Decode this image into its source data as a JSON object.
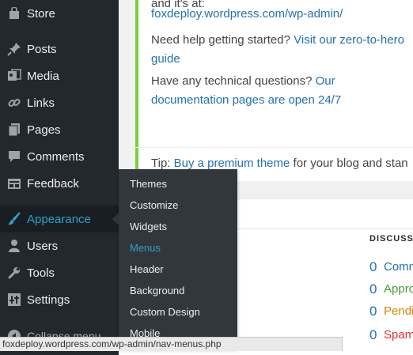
{
  "sidebar": {
    "items": [
      {
        "label": "Store",
        "icon": "store-icon"
      },
      {
        "label": "Posts",
        "icon": "pin-icon"
      },
      {
        "label": "Media",
        "icon": "media-icon"
      },
      {
        "label": "Links",
        "icon": "link-icon"
      },
      {
        "label": "Pages",
        "icon": "pages-icon"
      },
      {
        "label": "Comments",
        "icon": "comment-icon"
      },
      {
        "label": "Feedback",
        "icon": "feedback-icon"
      },
      {
        "label": "Appearance",
        "icon": "brush-icon"
      },
      {
        "label": "Users",
        "icon": "user-icon"
      },
      {
        "label": "Tools",
        "icon": "wrench-icon"
      },
      {
        "label": "Settings",
        "icon": "settings-icon"
      }
    ],
    "collapse_label": "Collapse menu",
    "active_color": "#2ea2cc"
  },
  "flyout": {
    "items": [
      "Themes",
      "Customize",
      "Widgets",
      "Menus",
      "Header",
      "Background",
      "Custom Design",
      "Mobile"
    ],
    "current": "Menus"
  },
  "main": {
    "card1": {
      "line0": "and it's at:",
      "url_link": "foxdeploy.wordpress.com/wp-admin/",
      "help_text": "Need help getting started?",
      "help_link": "Visit our zero-to-hero guide",
      "tech_text": "Have any technical questions?",
      "tech_link": "Our documentation pages are open 24/7"
    },
    "card2": {
      "tip_prefix": "Tip:",
      "tip_link": "Buy a premium theme",
      "tip_suffix": "for your blog and stan"
    },
    "discussion": {
      "title": "DISCUSSI",
      "rows": [
        {
          "count": "0",
          "label": "Comm",
          "color": "#2271b1"
        },
        {
          "count": "0",
          "label": "Appro",
          "color": "#46a02d"
        },
        {
          "count": "0",
          "label": "Pendi",
          "color": "#d98500"
        },
        {
          "count": "0",
          "label": "Spam",
          "color": "#dc3232"
        }
      ]
    }
  },
  "statusbar": {
    "url": "foxdeploy.wordpress.com/wp-admin/nav-menus.php"
  }
}
